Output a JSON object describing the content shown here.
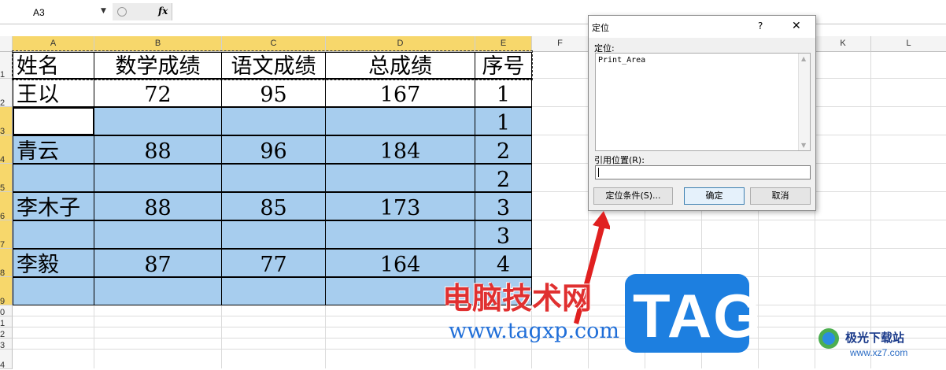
{
  "formula_bar": {
    "name_box": "A3",
    "fx_label": "fx"
  },
  "columns": [
    "A",
    "B",
    "C",
    "D",
    "E",
    "F",
    "G",
    "H",
    "I",
    "J",
    "K",
    "L"
  ],
  "rows": [
    "1",
    "2",
    "3",
    "4",
    "5",
    "6",
    "7",
    "8",
    "9",
    "0",
    "1",
    "2",
    "3",
    "4"
  ],
  "sheet": {
    "header": [
      "姓名",
      "数学成绩",
      "语文成绩",
      "总成绩",
      "序号"
    ],
    "rows": [
      [
        "王以",
        "72",
        "95",
        "167",
        "1"
      ],
      [
        "",
        "",
        "",
        "",
        "1"
      ],
      [
        "青云",
        "88",
        "96",
        "184",
        "2"
      ],
      [
        "",
        "",
        "",
        "",
        "2"
      ],
      [
        "李木子",
        "88",
        "85",
        "173",
        "3"
      ],
      [
        "",
        "",
        "",
        "",
        "3"
      ],
      [
        "李毅",
        "87",
        "77",
        "164",
        "4"
      ],
      [
        "",
        "",
        "",
        "",
        ""
      ]
    ]
  },
  "dialog": {
    "title": "定位",
    "help": "?",
    "close": "✕",
    "goto_label": "定位:",
    "list_items": [
      "Print_Area"
    ],
    "ref_label": "引用位置(R):",
    "ref_value": "",
    "special_button": "定位条件(S)...",
    "ok_button": "确定",
    "cancel_button": "取消"
  },
  "watermark": {
    "site_cn": "电脑技术网",
    "site_url": "www.tagxp.com",
    "tag_logo": "TAG",
    "corner_cn": "极光下载站",
    "corner_url": "www.xz7.com"
  },
  "colors": {
    "selection": "#a7cdee",
    "header_selected": "#f7d76b",
    "tag_blue": "#1d7fe0",
    "arrow_red": "#e02020"
  }
}
